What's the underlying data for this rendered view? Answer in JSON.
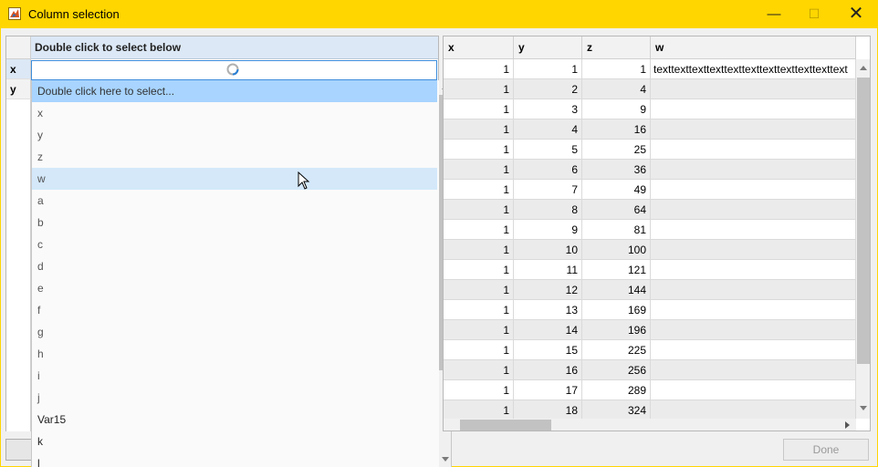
{
  "window": {
    "title": "Column selection",
    "minimize_icon": "minimize-icon",
    "maximize_icon": "maximize-icon",
    "close_icon": "close-icon",
    "title_bar_color": "#ffd600"
  },
  "left_table": {
    "column_header": "Double click to select below",
    "row_headers": [
      "x",
      "y"
    ]
  },
  "dropdown": {
    "items": [
      "Double click here to select...",
      "x",
      "y",
      "z",
      "w",
      "a",
      "b",
      "c",
      "d",
      "e",
      "f",
      "g",
      "h",
      "i",
      "j",
      "Var15",
      "k",
      "l"
    ],
    "selected_index": 0,
    "hover_index": 4
  },
  "right_table": {
    "columns": [
      "x",
      "y",
      "z",
      "w"
    ],
    "rows": [
      [
        "1",
        "1",
        "1",
        "texttexttexttexttexttexttexttexttexttexttext"
      ],
      [
        "1",
        "2",
        "4",
        ""
      ],
      [
        "1",
        "3",
        "9",
        ""
      ],
      [
        "1",
        "4",
        "16",
        ""
      ],
      [
        "1",
        "5",
        "25",
        ""
      ],
      [
        "1",
        "6",
        "36",
        ""
      ],
      [
        "1",
        "7",
        "49",
        ""
      ],
      [
        "1",
        "8",
        "64",
        ""
      ],
      [
        "1",
        "9",
        "81",
        ""
      ],
      [
        "1",
        "10",
        "100",
        ""
      ],
      [
        "1",
        "11",
        "121",
        ""
      ],
      [
        "1",
        "12",
        "144",
        ""
      ],
      [
        "1",
        "13",
        "169",
        ""
      ],
      [
        "1",
        "14",
        "196",
        ""
      ],
      [
        "1",
        "15",
        "225",
        ""
      ],
      [
        "1",
        "16",
        "256",
        ""
      ],
      [
        "1",
        "17",
        "289",
        ""
      ],
      [
        "1",
        "18",
        "324",
        ""
      ]
    ]
  },
  "buttons": {
    "done_label": "Done"
  },
  "colors": {
    "selection_blue": "#a8d4ff",
    "hover_blue": "#d4e8fa",
    "focus_border": "#3c8ddc"
  }
}
